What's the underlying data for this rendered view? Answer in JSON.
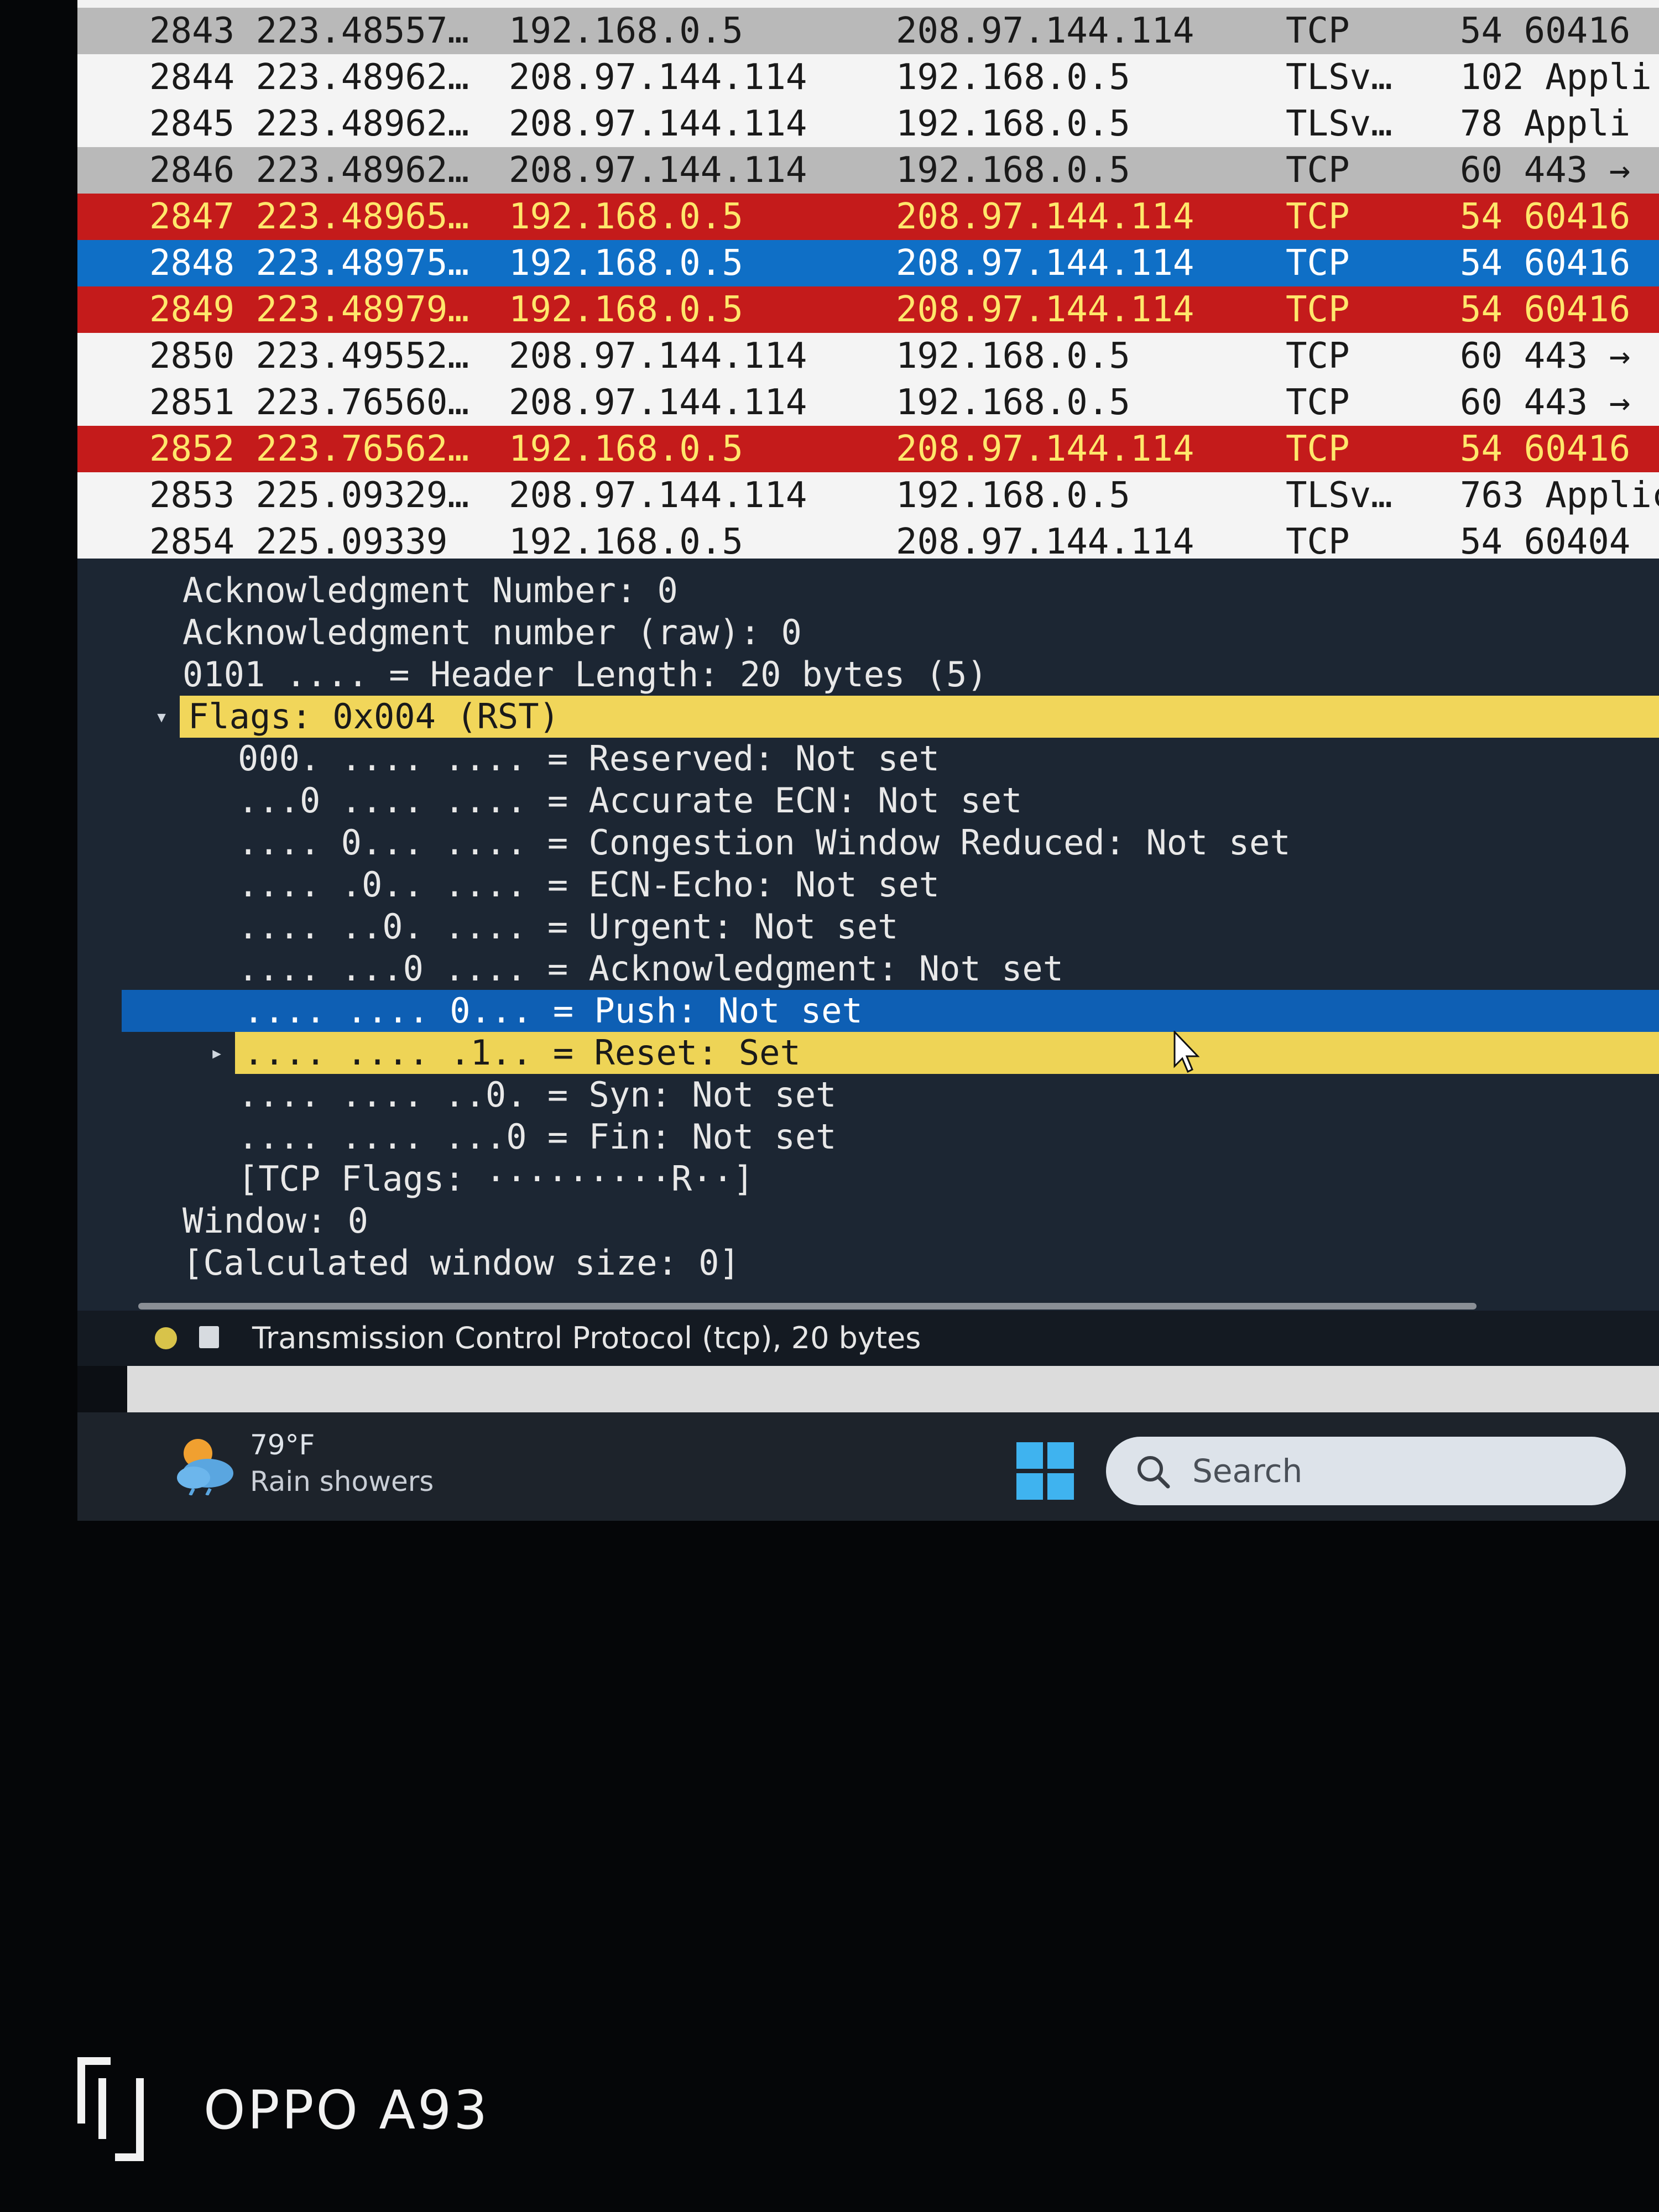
{
  "packets": [
    {
      "no": "2843",
      "time": "223.48557…",
      "src": "192.168.0.5",
      "dst": "208.97.144.114",
      "proto": "TCP",
      "info": "54 60416",
      "style": "gray"
    },
    {
      "no": "2844",
      "time": "223.48962…",
      "src": "208.97.144.114",
      "dst": "192.168.0.5",
      "proto": "TLSv…",
      "info": "102 Appli",
      "style": "white"
    },
    {
      "no": "2845",
      "time": "223.48962…",
      "src": "208.97.144.114",
      "dst": "192.168.0.5",
      "proto": "TLSv…",
      "info": "78 Appli",
      "style": "white"
    },
    {
      "no": "2846",
      "time": "223.48962…",
      "src": "208.97.144.114",
      "dst": "192.168.0.5",
      "proto": "TCP",
      "info": "60 443 →",
      "style": "gray"
    },
    {
      "no": "2847",
      "time": "223.48965…",
      "src": "192.168.0.5",
      "dst": "208.97.144.114",
      "proto": "TCP",
      "info": "54 60416",
      "style": "red"
    },
    {
      "no": "2848",
      "time": "223.48975…",
      "src": "192.168.0.5",
      "dst": "208.97.144.114",
      "proto": "TCP",
      "info": "54 60416",
      "style": "blue"
    },
    {
      "no": "2849",
      "time": "223.48979…",
      "src": "192.168.0.5",
      "dst": "208.97.144.114",
      "proto": "TCP",
      "info": "54 60416",
      "style": "red"
    },
    {
      "no": "2850",
      "time": "223.49552…",
      "src": "208.97.144.114",
      "dst": "192.168.0.5",
      "proto": "TCP",
      "info": "60 443 →",
      "style": "white"
    },
    {
      "no": "2851",
      "time": "223.76560…",
      "src": "208.97.144.114",
      "dst": "192.168.0.5",
      "proto": "TCP",
      "info": "60 443 →",
      "style": "white"
    },
    {
      "no": "2852",
      "time": "223.76562…",
      "src": "192.168.0.5",
      "dst": "208.97.144.114",
      "proto": "TCP",
      "info": "54 60416",
      "style": "red"
    },
    {
      "no": "2853",
      "time": "225.09329…",
      "src": "208.97.144.114",
      "dst": "192.168.0.5",
      "proto": "TLSv…",
      "info": "763 Applic",
      "style": "white"
    },
    {
      "no": "2854",
      "time": "225.09339",
      "src": "192.168.0.5",
      "dst": "208.97.144.114",
      "proto": "TCP",
      "info": "54 60404",
      "style": "white"
    }
  ],
  "details": [
    {
      "text": "Acknowledgment Number: 0",
      "indent": 0,
      "style": ""
    },
    {
      "text": "Acknowledgment number (raw): 0",
      "indent": 0,
      "style": ""
    },
    {
      "text": "0101 .... = Header Length: 20 bytes (5)",
      "indent": 0,
      "style": ""
    },
    {
      "text": "Flags: 0x004 (RST)",
      "indent": 0,
      "style": "flags",
      "expander": "▾"
    },
    {
      "text": "000. .... .... = Reserved: Not set",
      "indent": 1,
      "style": ""
    },
    {
      "text": "...0 .... .... = Accurate ECN: Not set",
      "indent": 1,
      "style": ""
    },
    {
      "text": ".... 0... .... = Congestion Window Reduced: Not set",
      "indent": 1,
      "style": ""
    },
    {
      "text": ".... .0.. .... = ECN-Echo: Not set",
      "indent": 1,
      "style": ""
    },
    {
      "text": ".... ..0. .... = Urgent: Not set",
      "indent": 1,
      "style": ""
    },
    {
      "text": ".... ...0 .... = Acknowledgment: Not set",
      "indent": 1,
      "style": ""
    },
    {
      "text": ".... .... 0... = Push: Not set",
      "indent": 1,
      "style": "push"
    },
    {
      "text": ".... .... .1.. = Reset: Set",
      "indent": 1,
      "style": "reset",
      "expander": "▸"
    },
    {
      "text": ".... .... ..0. = Syn: Not set",
      "indent": 1,
      "style": ""
    },
    {
      "text": ".... .... ...0 = Fin: Not set",
      "indent": 1,
      "style": ""
    },
    {
      "text": "[TCP Flags: ·········R··]",
      "indent": 1,
      "style": ""
    },
    {
      "text": "Window: 0",
      "indent": 0,
      "style": ""
    },
    {
      "text": "[Calculated window size: 0]",
      "indent": 0,
      "style": ""
    }
  ],
  "status": {
    "text": "Transmission Control Protocol (tcp), 20 bytes"
  },
  "taskbar": {
    "weather_temp": "79°F",
    "weather_desc": "Rain showers",
    "search_placeholder": "Search"
  },
  "watermark": {
    "text": "OPPO A93"
  },
  "colors": {
    "red_row": "#c41b1b",
    "blue_row": "#0f6fc6",
    "flags_highlight": "#f1d65a",
    "details_bg": "#1c2633"
  }
}
